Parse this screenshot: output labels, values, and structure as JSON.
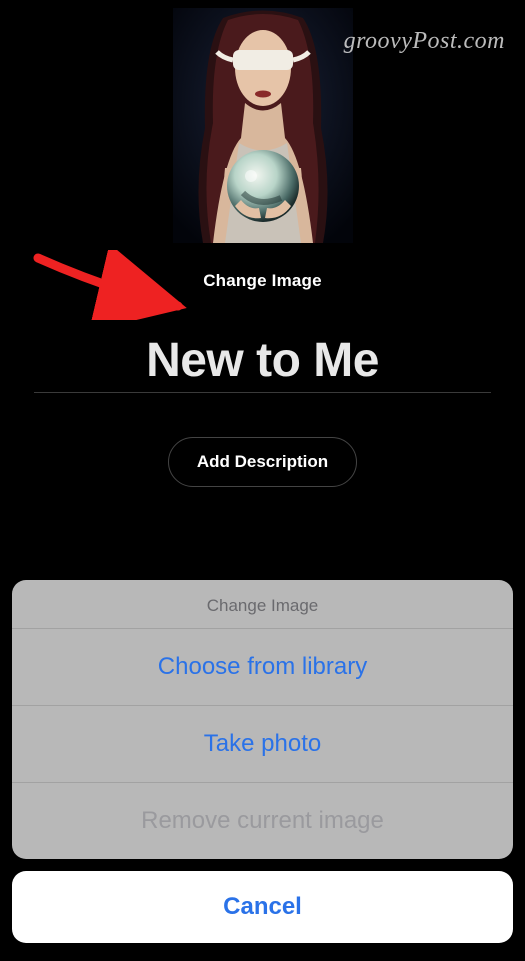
{
  "watermark": "groovyPost.com",
  "cover": {
    "change_label": "Change Image"
  },
  "playlist": {
    "title": "New to Me",
    "add_description_label": "Add Description"
  },
  "action_sheet": {
    "title": "Change Image",
    "choose_library": "Choose from library",
    "take_photo": "Take photo",
    "remove_image": "Remove current image",
    "cancel": "Cancel"
  }
}
